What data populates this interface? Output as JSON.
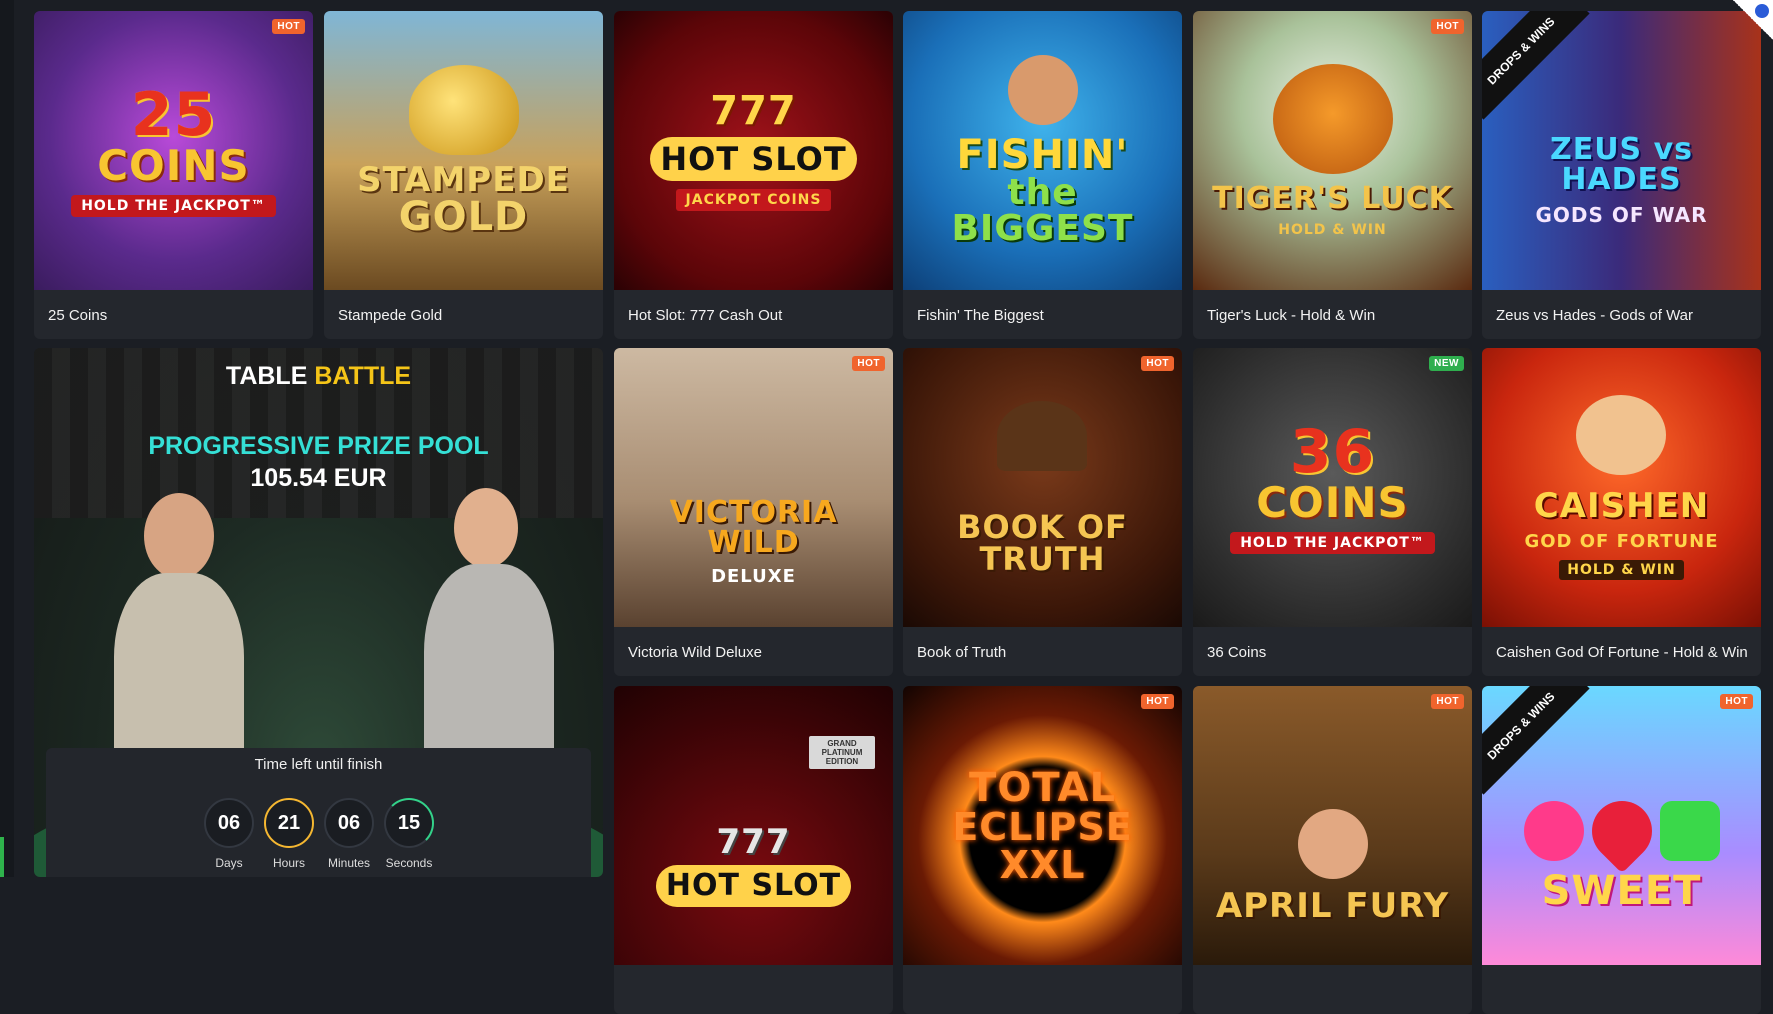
{
  "games_row1": [
    {
      "title": "25 Coins",
      "badge": "HOT",
      "art_line1": "25",
      "art_line2": "COINS",
      "art_line3": "HOLD THE JACKPOT™"
    },
    {
      "title": "Stampede Gold",
      "badge": "",
      "art_line1": "STAMPEDE",
      "art_line2": "GOLD",
      "art_line3": ""
    },
    {
      "title": "Hot Slot: 777 Cash Out",
      "badge": "",
      "art_line1": "777",
      "art_line2": "HOT SLOT",
      "art_line3": "JACKPOT COINS"
    },
    {
      "title": "Fishin' The Biggest",
      "badge": "",
      "art_line1": "FISHIN'",
      "art_line2": "the BIGGEST",
      "art_line3": ""
    },
    {
      "title": "Tiger's Luck - Hold & Win",
      "badge": "HOT",
      "art_line1": "TIGER'S LUCK",
      "art_line2": "HOLD & WIN",
      "art_line3": ""
    },
    {
      "title": "Zeus vs Hades - Gods of War",
      "badge": "",
      "ribbon": "DROPS & WINS",
      "art_line1": "ZEUS vs HADES",
      "art_line2": "GODS OF WAR",
      "art_line3": ""
    }
  ],
  "games_row2": [
    {
      "title": "Victoria Wild Deluxe",
      "badge": "HOT",
      "art_line1": "VICTORIA WILD",
      "art_line2": "DELUXE",
      "art_line3": ""
    },
    {
      "title": "Book of Truth",
      "badge": "HOT",
      "art_line1": "BOOK OF",
      "art_line2": "TRUTH",
      "art_line3": ""
    },
    {
      "title": "36 Coins",
      "badge": "NEW",
      "art_line1": "36",
      "art_line2": "COINS",
      "art_line3": "HOLD THE JACKPOT™"
    },
    {
      "title": "Caishen God Of Fortune - Hold & Win",
      "badge": "",
      "art_line1": "CAISHEN",
      "art_line2": "GOD OF FORTUNE",
      "art_line3": "HOLD & WIN"
    }
  ],
  "games_row3": [
    {
      "badge": "",
      "art_line1": "777",
      "art_line2": "HOT SLOT",
      "art_line3": "GRAND PLATINUM EDITION"
    },
    {
      "badge": "HOT",
      "art_line1": "TOTAL",
      "art_line2": "ECLIPSE XXL",
      "art_line3": ""
    },
    {
      "badge": "HOT",
      "art_line1": "APRIL FURY",
      "art_line2": "",
      "art_line3": ""
    },
    {
      "badge": "HOT",
      "ribbon": "DROPS & WINS",
      "art_line1": "SWEET",
      "art_line2": "",
      "art_line3": ""
    }
  ],
  "promo": {
    "title_part1": "TABLE",
    "title_part2": "BATTLE",
    "subtitle": "PROGRESSIVE PRIZE POOL",
    "amount": "105.54 EUR",
    "countdown_label": "Time left until finish",
    "countdown": [
      {
        "value": "06",
        "unit": "Days"
      },
      {
        "value": "21",
        "unit": "Hours"
      },
      {
        "value": "06",
        "unit": "Minutes"
      },
      {
        "value": "15",
        "unit": "Seconds"
      }
    ]
  },
  "colors": {
    "page_bg": "#1b1e24",
    "card_bg": "#24272d",
    "hot_badge": "#f0642d",
    "new_badge": "#2fae4e",
    "battle_accent": "#f5c518",
    "prize_accent": "#35e0d6"
  }
}
